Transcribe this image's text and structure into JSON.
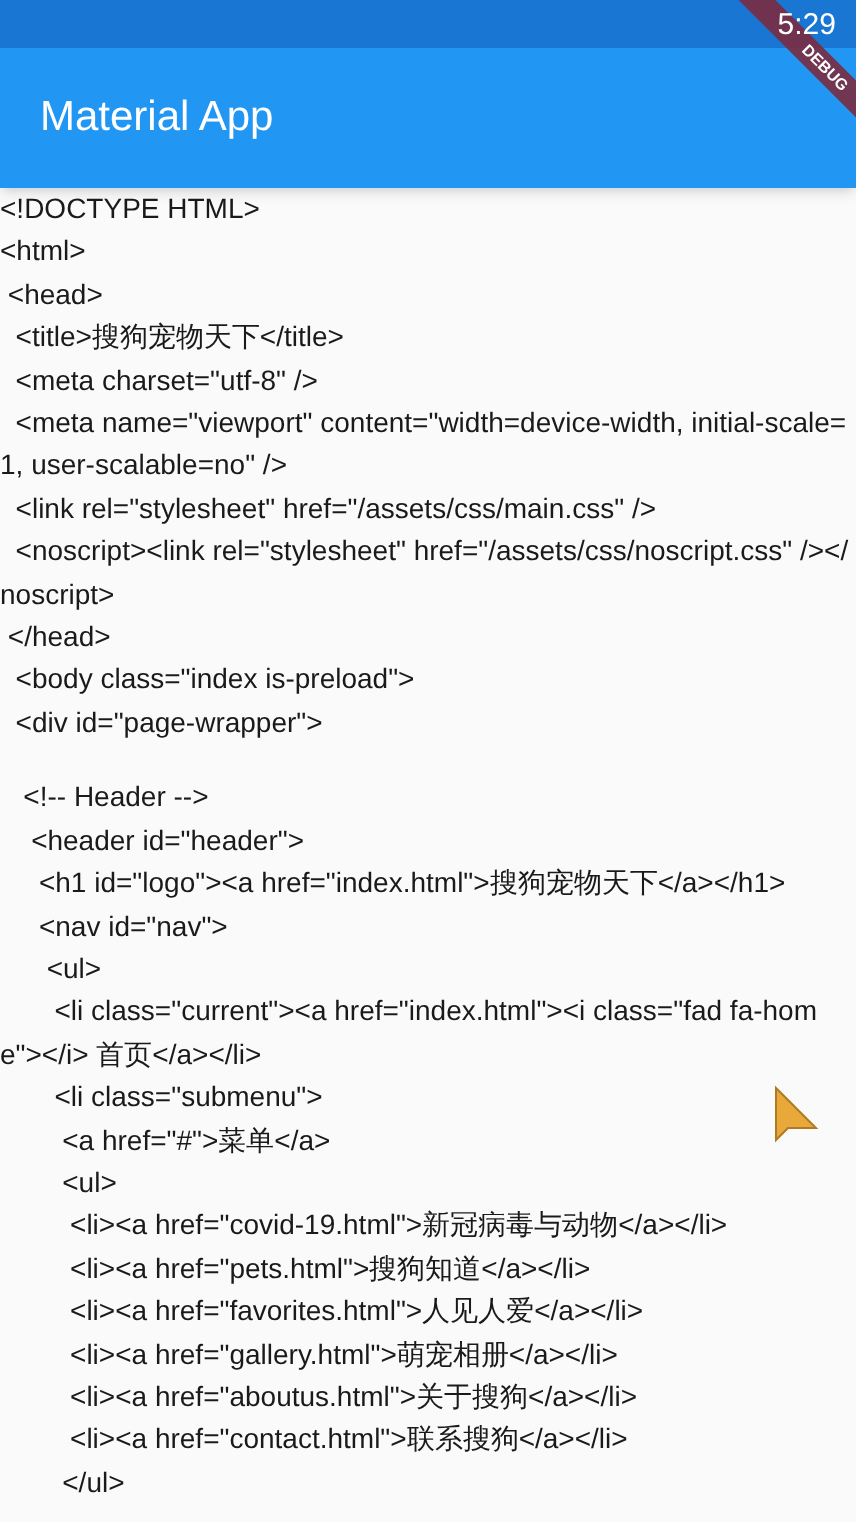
{
  "status_bar": {
    "time": "5:29"
  },
  "debug_banner": {
    "label": "DEBUG"
  },
  "app_bar": {
    "title": "Material App"
  },
  "source_lines": [
    {
      "kind": "code",
      "text": "<!DOCTYPE HTML>"
    },
    {
      "kind": "code",
      "text": "<html>"
    },
    {
      "kind": "code",
      "text": " <head>"
    },
    {
      "kind": "code",
      "text": "  <title>搜狗宠物天下</title>"
    },
    {
      "kind": "code",
      "text": "  <meta charset=\"utf-8\" />"
    },
    {
      "kind": "code",
      "text": "  <meta name=\"viewport\" content=\"width=device-width, initial-scale=1, user-scalable=no\" />"
    },
    {
      "kind": "code",
      "text": "  <link rel=\"stylesheet\" href=\"/assets/css/main.css\" />"
    },
    {
      "kind": "code",
      "text": "  <noscript><link rel=\"stylesheet\" href=\"/assets/css/noscript.css\" /></noscript>"
    },
    {
      "kind": "code",
      "text": " </head>"
    },
    {
      "kind": "code",
      "text": "  <body class=\"index is-preload\">"
    },
    {
      "kind": "code",
      "text": "  <div id=\"page-wrapper\">"
    },
    {
      "kind": "blank"
    },
    {
      "kind": "code",
      "text": "   <!-- Header -->"
    },
    {
      "kind": "code",
      "text": "    <header id=\"header\">"
    },
    {
      "kind": "code",
      "text": "     <h1 id=\"logo\"><a href=\"index.html\">搜狗宠物天下</a></h1>"
    },
    {
      "kind": "code",
      "text": "     <nav id=\"nav\">"
    },
    {
      "kind": "code",
      "text": "      <ul>"
    },
    {
      "kind": "code",
      "text": "       <li class=\"current\"><a href=\"index.html\"><i class=\"fad fa-home\"></i> 首页</a></li>"
    },
    {
      "kind": "code",
      "text": "       <li class=\"submenu\">"
    },
    {
      "kind": "code",
      "text": "        <a href=\"#\">菜单</a>"
    },
    {
      "kind": "code",
      "text": "        <ul>"
    },
    {
      "kind": "code",
      "text": "         <li><a href=\"covid-19.html\">新冠病毒与动物</a></li>"
    },
    {
      "kind": "code",
      "text": "         <li><a href=\"pets.html\">搜狗知道</a></li>"
    },
    {
      "kind": "code",
      "text": "         <li><a href=\"favorites.html\">人见人爱</a></li>"
    },
    {
      "kind": "code",
      "text": "         <li><a href=\"gallery.html\">萌宠相册</a></li>"
    },
    {
      "kind": "code",
      "text": "         <li><a href=\"aboutus.html\">关于搜狗</a></li>"
    },
    {
      "kind": "code",
      "text": "         <li><a href=\"contact.html\">联系搜狗</a></li>"
    },
    {
      "kind": "code",
      "text": "        </ul>"
    }
  ]
}
